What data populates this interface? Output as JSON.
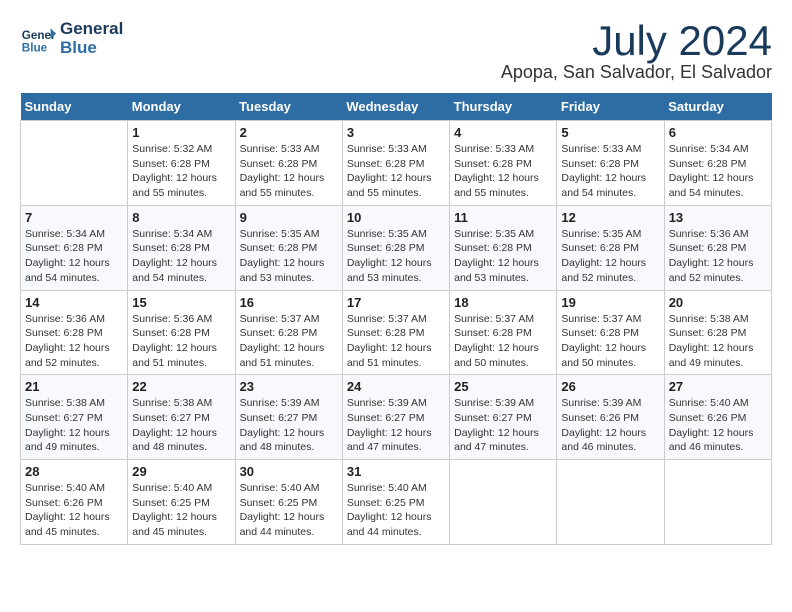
{
  "header": {
    "logo_line1": "General",
    "logo_line2": "Blue",
    "month_year": "July 2024",
    "location": "Apopa, San Salvador, El Salvador"
  },
  "days_of_week": [
    "Sunday",
    "Monday",
    "Tuesday",
    "Wednesday",
    "Thursday",
    "Friday",
    "Saturday"
  ],
  "weeks": [
    [
      {
        "day": "",
        "info": ""
      },
      {
        "day": "1",
        "info": "Sunrise: 5:32 AM\nSunset: 6:28 PM\nDaylight: 12 hours\nand 55 minutes."
      },
      {
        "day": "2",
        "info": "Sunrise: 5:33 AM\nSunset: 6:28 PM\nDaylight: 12 hours\nand 55 minutes."
      },
      {
        "day": "3",
        "info": "Sunrise: 5:33 AM\nSunset: 6:28 PM\nDaylight: 12 hours\nand 55 minutes."
      },
      {
        "day": "4",
        "info": "Sunrise: 5:33 AM\nSunset: 6:28 PM\nDaylight: 12 hours\nand 55 minutes."
      },
      {
        "day": "5",
        "info": "Sunrise: 5:33 AM\nSunset: 6:28 PM\nDaylight: 12 hours\nand 54 minutes."
      },
      {
        "day": "6",
        "info": "Sunrise: 5:34 AM\nSunset: 6:28 PM\nDaylight: 12 hours\nand 54 minutes."
      }
    ],
    [
      {
        "day": "7",
        "info": "Sunrise: 5:34 AM\nSunset: 6:28 PM\nDaylight: 12 hours\nand 54 minutes."
      },
      {
        "day": "8",
        "info": "Sunrise: 5:34 AM\nSunset: 6:28 PM\nDaylight: 12 hours\nand 54 minutes."
      },
      {
        "day": "9",
        "info": "Sunrise: 5:35 AM\nSunset: 6:28 PM\nDaylight: 12 hours\nand 53 minutes."
      },
      {
        "day": "10",
        "info": "Sunrise: 5:35 AM\nSunset: 6:28 PM\nDaylight: 12 hours\nand 53 minutes."
      },
      {
        "day": "11",
        "info": "Sunrise: 5:35 AM\nSunset: 6:28 PM\nDaylight: 12 hours\nand 53 minutes."
      },
      {
        "day": "12",
        "info": "Sunrise: 5:35 AM\nSunset: 6:28 PM\nDaylight: 12 hours\nand 52 minutes."
      },
      {
        "day": "13",
        "info": "Sunrise: 5:36 AM\nSunset: 6:28 PM\nDaylight: 12 hours\nand 52 minutes."
      }
    ],
    [
      {
        "day": "14",
        "info": "Sunrise: 5:36 AM\nSunset: 6:28 PM\nDaylight: 12 hours\nand 52 minutes."
      },
      {
        "day": "15",
        "info": "Sunrise: 5:36 AM\nSunset: 6:28 PM\nDaylight: 12 hours\nand 51 minutes."
      },
      {
        "day": "16",
        "info": "Sunrise: 5:37 AM\nSunset: 6:28 PM\nDaylight: 12 hours\nand 51 minutes."
      },
      {
        "day": "17",
        "info": "Sunrise: 5:37 AM\nSunset: 6:28 PM\nDaylight: 12 hours\nand 51 minutes."
      },
      {
        "day": "18",
        "info": "Sunrise: 5:37 AM\nSunset: 6:28 PM\nDaylight: 12 hours\nand 50 minutes."
      },
      {
        "day": "19",
        "info": "Sunrise: 5:37 AM\nSunset: 6:28 PM\nDaylight: 12 hours\nand 50 minutes."
      },
      {
        "day": "20",
        "info": "Sunrise: 5:38 AM\nSunset: 6:28 PM\nDaylight: 12 hours\nand 49 minutes."
      }
    ],
    [
      {
        "day": "21",
        "info": "Sunrise: 5:38 AM\nSunset: 6:27 PM\nDaylight: 12 hours\nand 49 minutes."
      },
      {
        "day": "22",
        "info": "Sunrise: 5:38 AM\nSunset: 6:27 PM\nDaylight: 12 hours\nand 48 minutes."
      },
      {
        "day": "23",
        "info": "Sunrise: 5:39 AM\nSunset: 6:27 PM\nDaylight: 12 hours\nand 48 minutes."
      },
      {
        "day": "24",
        "info": "Sunrise: 5:39 AM\nSunset: 6:27 PM\nDaylight: 12 hours\nand 47 minutes."
      },
      {
        "day": "25",
        "info": "Sunrise: 5:39 AM\nSunset: 6:27 PM\nDaylight: 12 hours\nand 47 minutes."
      },
      {
        "day": "26",
        "info": "Sunrise: 5:39 AM\nSunset: 6:26 PM\nDaylight: 12 hours\nand 46 minutes."
      },
      {
        "day": "27",
        "info": "Sunrise: 5:40 AM\nSunset: 6:26 PM\nDaylight: 12 hours\nand 46 minutes."
      }
    ],
    [
      {
        "day": "28",
        "info": "Sunrise: 5:40 AM\nSunset: 6:26 PM\nDaylight: 12 hours\nand 45 minutes."
      },
      {
        "day": "29",
        "info": "Sunrise: 5:40 AM\nSunset: 6:25 PM\nDaylight: 12 hours\nand 45 minutes."
      },
      {
        "day": "30",
        "info": "Sunrise: 5:40 AM\nSunset: 6:25 PM\nDaylight: 12 hours\nand 44 minutes."
      },
      {
        "day": "31",
        "info": "Sunrise: 5:40 AM\nSunset: 6:25 PM\nDaylight: 12 hours\nand 44 minutes."
      },
      {
        "day": "",
        "info": ""
      },
      {
        "day": "",
        "info": ""
      },
      {
        "day": "",
        "info": ""
      }
    ]
  ]
}
